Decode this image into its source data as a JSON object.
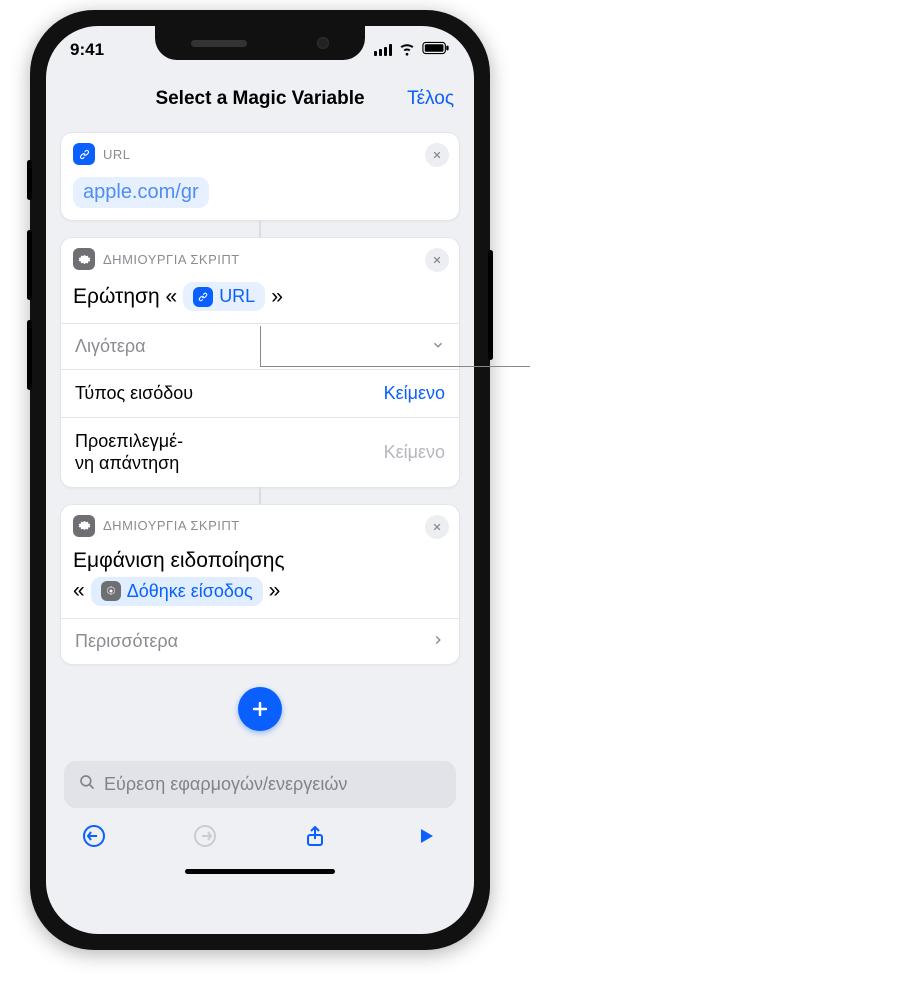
{
  "status": {
    "time": "9:41"
  },
  "nav": {
    "title": "Select a Magic Variable",
    "done": "Τέλος"
  },
  "card_url": {
    "header": "URL",
    "value": "apple.com/gr"
  },
  "card_ask": {
    "header": "ΔΗΜΙΟΥΡΓΙΑ ΣΚΡΙΠΤ",
    "prefix": "Ερώτηση «",
    "var_label": "URL",
    "suffix": "»",
    "less": "Λιγότερα",
    "rows": {
      "input_type_label": "Τύπος εισόδου",
      "input_type_value": "Κείμενο",
      "default_label": "Προεπιλεγμέ-\nνη απάντηση",
      "default_value": "Κείμενο"
    }
  },
  "card_alert": {
    "header": "ΔΗΜΙΟΥΡΓΙΑ ΣΚΡΙΠΤ",
    "line1": "Εμφάνιση ειδοποίησης",
    "line2_prefix": "«",
    "var_label": "Δόθηκε είσοδος",
    "line2_suffix": "»",
    "more": "Περισσότερα"
  },
  "search": {
    "placeholder": "Εύρεση εφαρμογών/ενεργειών"
  },
  "callout": {
    "text": ""
  }
}
